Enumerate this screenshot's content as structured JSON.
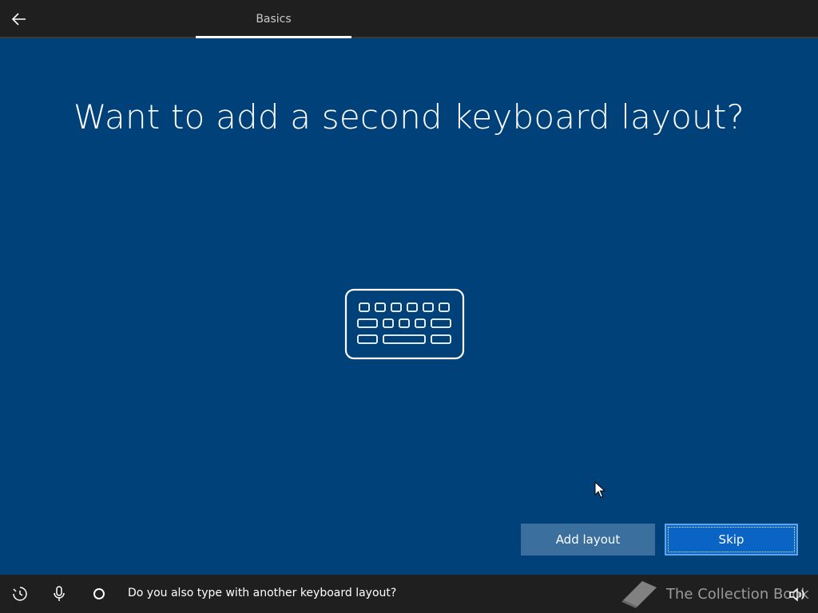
{
  "header": {
    "back_icon": "arrow-left-icon",
    "tab_label": "Basics"
  },
  "main": {
    "title": "Want to add a second keyboard layout?",
    "illustration": "keyboard-icon"
  },
  "buttons": {
    "add_layout": "Add layout",
    "skip": "Skip"
  },
  "footer": {
    "icons": [
      "ease-of-access-icon",
      "microphone-icon",
      "cortana-circle-icon",
      "volume-icon"
    ],
    "status": "Do you also type with another keyboard layout?",
    "watermark": "The Collection Book"
  },
  "colors": {
    "background": "#00417a",
    "bar": "#1f1f1f",
    "primary_button": "#0a64c6",
    "secondary_button": "#3a6f9e"
  }
}
